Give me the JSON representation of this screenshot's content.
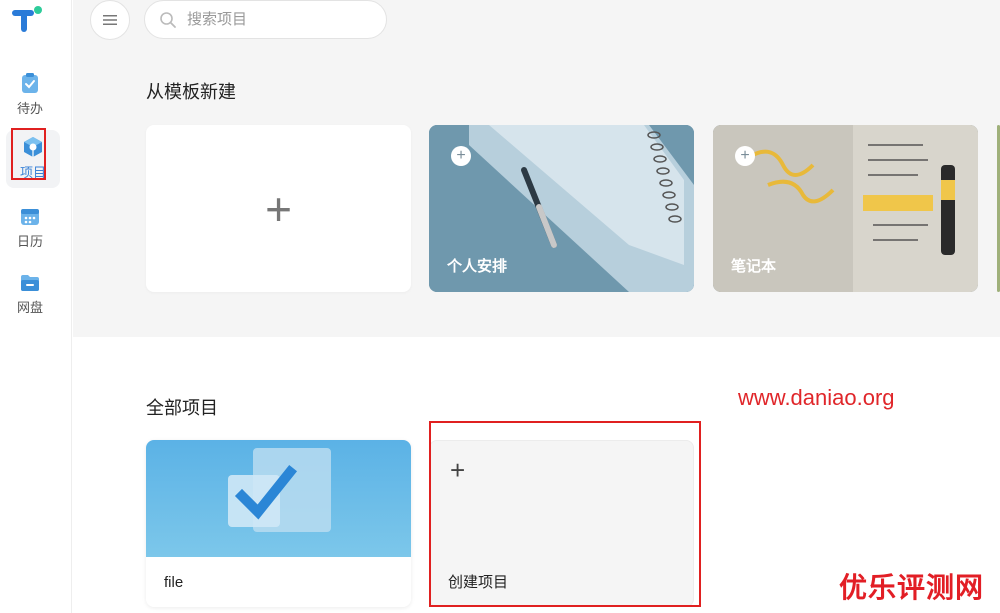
{
  "sidebar": {
    "items": [
      {
        "label": "待办",
        "icon": "clipboard-check-icon"
      },
      {
        "label": "项目",
        "icon": "cube-icon",
        "active": true
      },
      {
        "label": "日历",
        "icon": "calendar-icon"
      },
      {
        "label": "网盘",
        "icon": "folder-icon"
      }
    ]
  },
  "search": {
    "placeholder": "搜索项目"
  },
  "templates": {
    "title": "从模板新建",
    "cards": [
      {
        "label": ""
      },
      {
        "label": "个人安排"
      },
      {
        "label": "笔记本"
      }
    ]
  },
  "projects": {
    "title": "全部项目",
    "items": [
      {
        "name": "file"
      },
      {
        "name": "创建项目"
      }
    ]
  },
  "watermark": {
    "url": "www.daniao.org",
    "brand": "优乐评测网"
  },
  "colors": {
    "accent": "#3b82d6",
    "annotation": "#e02020",
    "top_bg": "#f5f5f5"
  }
}
